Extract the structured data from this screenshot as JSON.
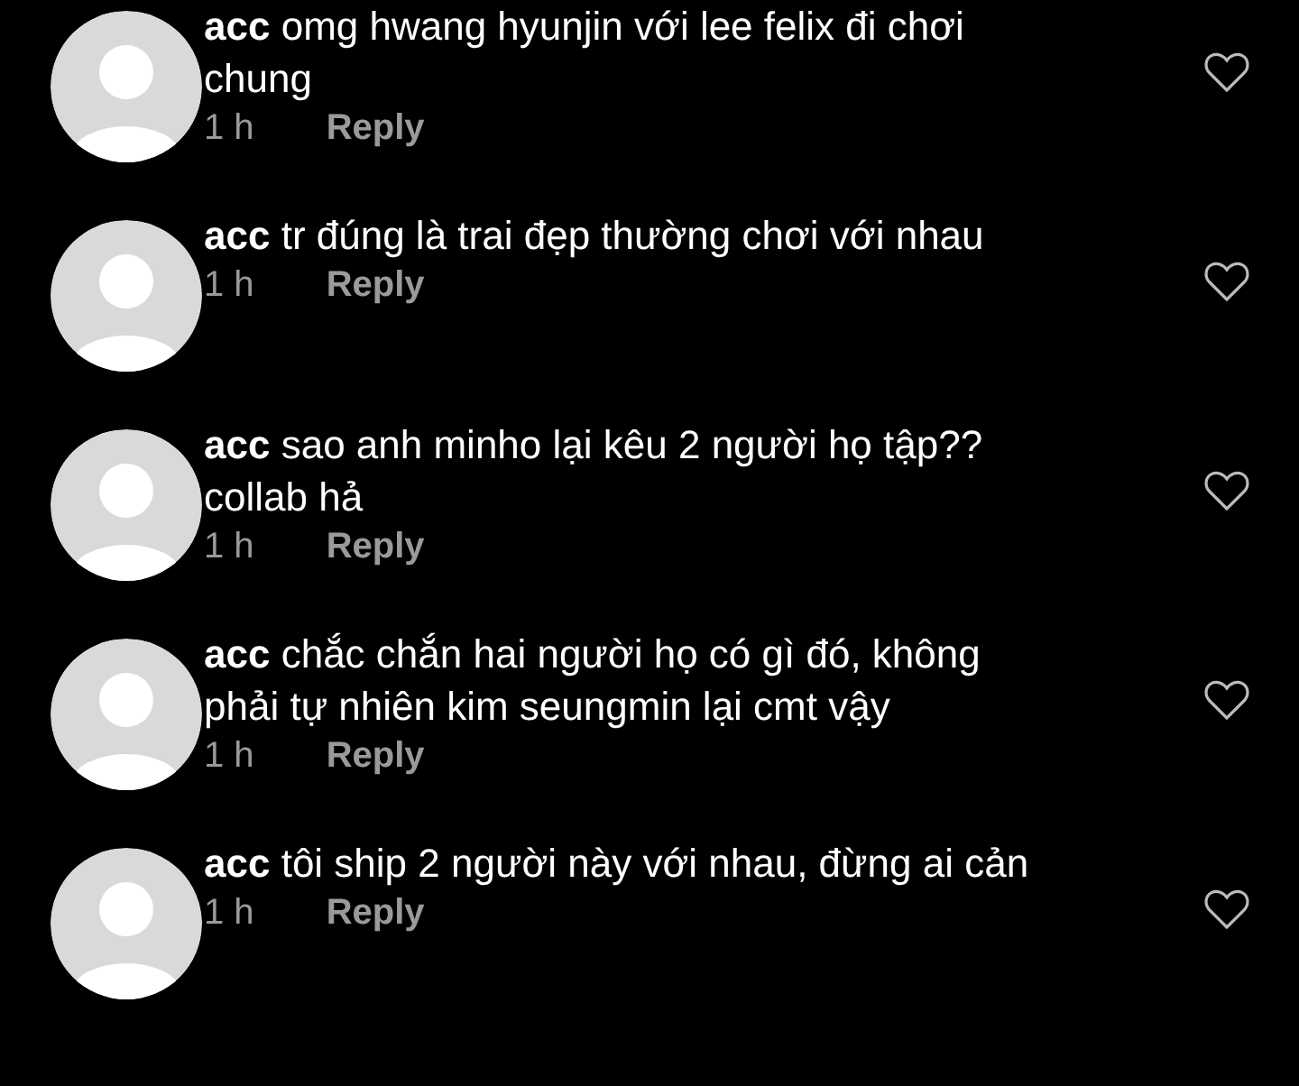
{
  "comments": [
    {
      "text": "**acc** omg hwang hyunjin với lee felix đi chơi chung",
      "time": "1 h",
      "reply": "Reply",
      "liked": false
    },
    {
      "text": "**acc** tr đúng là trai đẹp thường chơi với nhau",
      "time": "1 h",
      "reply": "Reply",
      "liked": false
    },
    {
      "text": "**acc** sao anh minho lại kêu 2 người họ tập?? collab hả",
      "time": "1 h",
      "reply": "Reply",
      "liked": false
    },
    {
      "text": "**acc** chắc chắn hai người họ có gì đó, không phải tự nhiên kim seungmin lại cmt vậy",
      "time": "1 h",
      "reply": "Reply",
      "liked": false
    },
    {
      "text": "**acc** tôi ship 2 người này với nhau, đừng ai cản",
      "time": "1 h",
      "reply": "Reply",
      "liked": false
    }
  ]
}
